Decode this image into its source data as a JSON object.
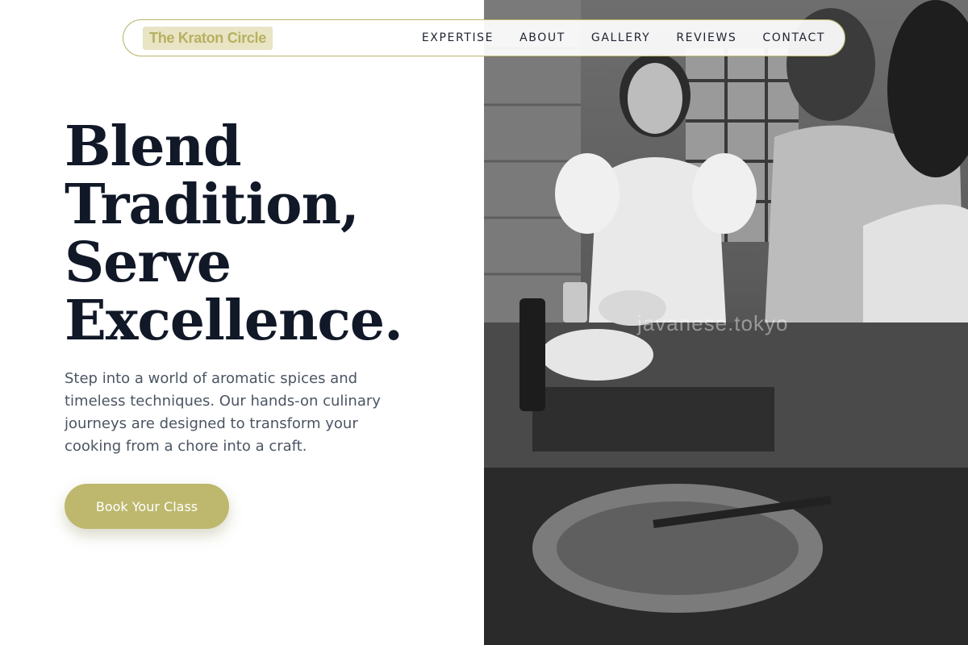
{
  "brand": {
    "name": "The Kraton Circle"
  },
  "nav": {
    "items": [
      {
        "label": "EXPERTISE"
      },
      {
        "label": "ABOUT"
      },
      {
        "label": "GALLERY"
      },
      {
        "label": "REVIEWS"
      },
      {
        "label": "CONTACT"
      }
    ]
  },
  "hero": {
    "headline": [
      "Blend",
      "Tradition,",
      "Serve",
      "Excellence."
    ],
    "lead": "Step into a world of aromatic spices and timeless techniques. Our hands-on culinary journeys are designed to transform your cooking from a chore into a craft.",
    "cta_label": "Book Your Class",
    "photo_watermark": "javanese.tokyo"
  },
  "colors": {
    "accent": "#bdb86d",
    "brand_bg": "#e8e4c4",
    "brand_text": "#b7b060",
    "heading": "#111827",
    "body_text": "#4b5563"
  }
}
